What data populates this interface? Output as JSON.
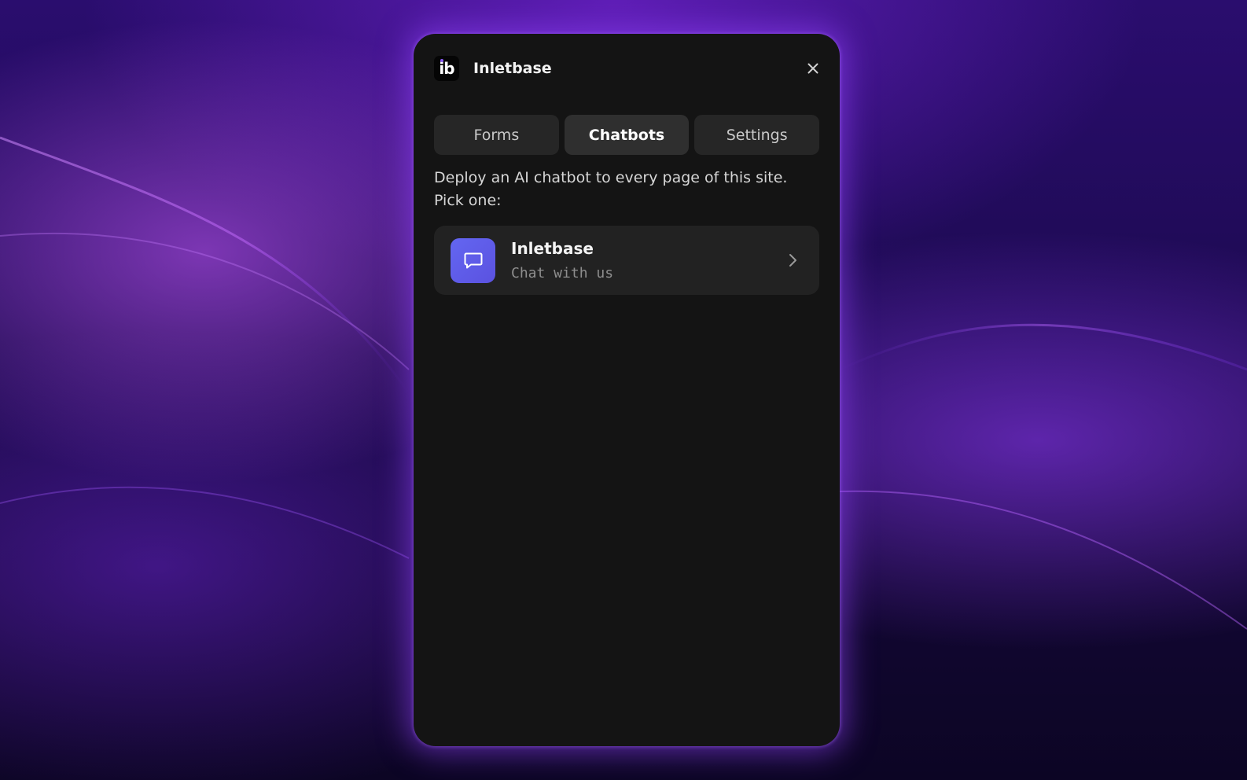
{
  "header": {
    "logo_text": "ib",
    "app_title": "Inletbase",
    "close_icon": "close-icon"
  },
  "tabs": [
    {
      "label": "Forms",
      "active": false
    },
    {
      "label": "Chatbots",
      "active": true
    },
    {
      "label": "Settings",
      "active": false
    }
  ],
  "main": {
    "description_line1": "Deploy an AI chatbot to every page of this site.",
    "description_line2": "Pick one:",
    "chatbots": [
      {
        "name": "Inletbase",
        "subtitle": "Chat with us",
        "icon": "chat-bubble-icon",
        "icon_color": "#6366f1"
      }
    ]
  },
  "colors": {
    "panel_bg": "#141414",
    "tab_bg": "#262626",
    "card_bg": "#222222",
    "accent": "#6366f1",
    "glow": "#9646ff"
  }
}
